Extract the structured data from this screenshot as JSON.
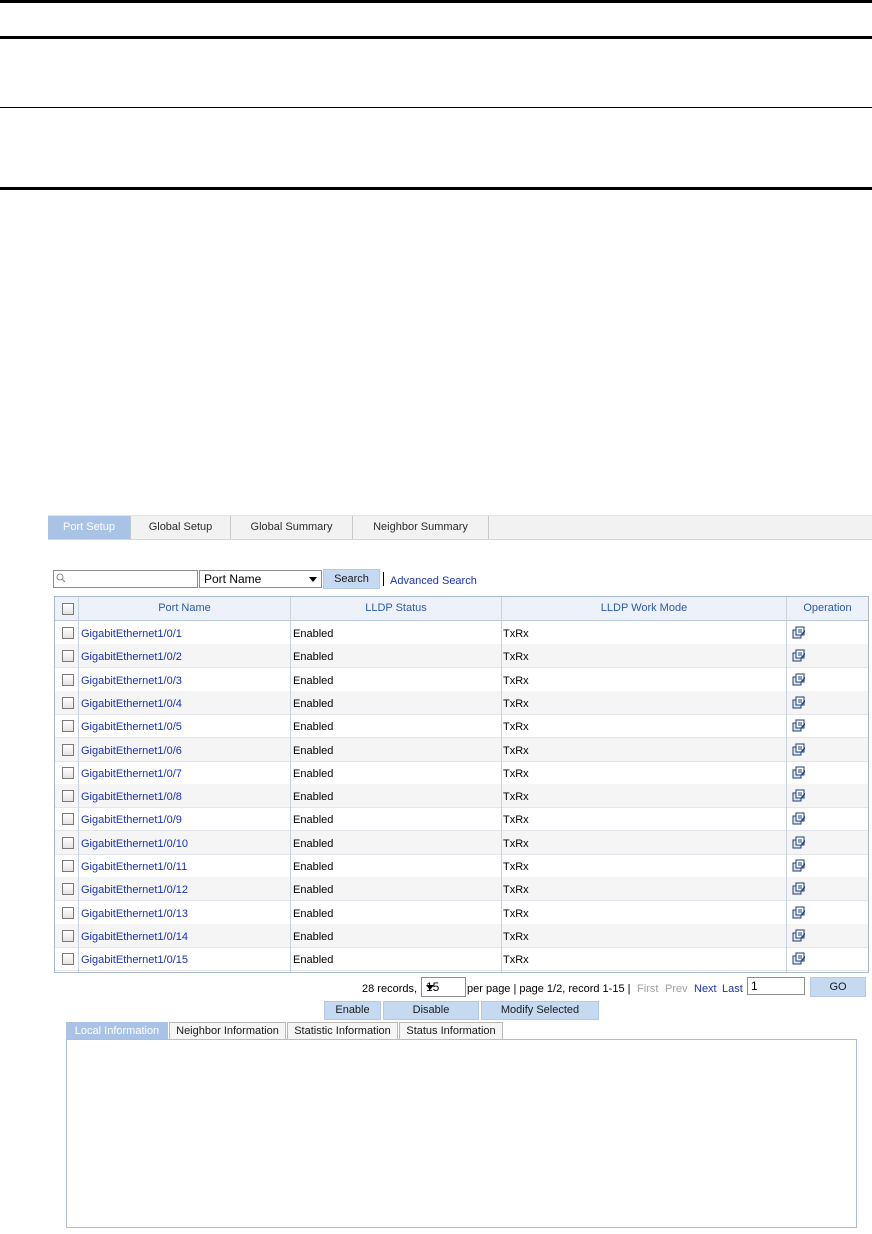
{
  "main_tabs": [
    "Port Setup",
    "Global Setup",
    "Global Summary",
    "Neighbor Summary"
  ],
  "search": {
    "input_value": "",
    "field_select": "Port Name",
    "search_label": "Search",
    "advanced_label": "Advanced Search"
  },
  "table": {
    "headers": [
      "Port Name",
      "LLDP Status",
      "LLDP Work Mode",
      "Operation"
    ],
    "rows": [
      {
        "port": "GigabitEthernet1/0/1",
        "status": "Enabled",
        "mode": "TxRx"
      },
      {
        "port": "GigabitEthernet1/0/2",
        "status": "Enabled",
        "mode": "TxRx"
      },
      {
        "port": "GigabitEthernet1/0/3",
        "status": "Enabled",
        "mode": "TxRx"
      },
      {
        "port": "GigabitEthernet1/0/4",
        "status": "Enabled",
        "mode": "TxRx"
      },
      {
        "port": "GigabitEthernet1/0/5",
        "status": "Enabled",
        "mode": "TxRx"
      },
      {
        "port": "GigabitEthernet1/0/6",
        "status": "Enabled",
        "mode": "TxRx"
      },
      {
        "port": "GigabitEthernet1/0/7",
        "status": "Enabled",
        "mode": "TxRx"
      },
      {
        "port": "GigabitEthernet1/0/8",
        "status": "Enabled",
        "mode": "TxRx"
      },
      {
        "port": "GigabitEthernet1/0/9",
        "status": "Enabled",
        "mode": "TxRx"
      },
      {
        "port": "GigabitEthernet1/0/10",
        "status": "Enabled",
        "mode": "TxRx"
      },
      {
        "port": "GigabitEthernet1/0/11",
        "status": "Enabled",
        "mode": "TxRx"
      },
      {
        "port": "GigabitEthernet1/0/12",
        "status": "Enabled",
        "mode": "TxRx"
      },
      {
        "port": "GigabitEthernet1/0/13",
        "status": "Enabled",
        "mode": "TxRx"
      },
      {
        "port": "GigabitEthernet1/0/14",
        "status": "Enabled",
        "mode": "TxRx"
      },
      {
        "port": "GigabitEthernet1/0/15",
        "status": "Enabled",
        "mode": "TxRx"
      }
    ],
    "operation_icon": "edit-icon"
  },
  "pagination": {
    "records_text": "28 records,",
    "per_page_value": "15",
    "per_page_text": "per page | page 1/2, record 1-15 |",
    "first": "First",
    "prev": "Prev",
    "next": "Next",
    "last": "Last",
    "page_input": "1",
    "go_label": "GO"
  },
  "actions": [
    "Enable",
    "Disable",
    "Modify Selected"
  ],
  "sub_tabs": [
    "Local Information",
    "Neighbor Information",
    "Statistic Information",
    "Status Information"
  ],
  "colors": {
    "active_tab": "#a9c3e6",
    "button": "#c5d9f1",
    "link": "#1a33b2",
    "header_text": "#2d5aa8"
  }
}
